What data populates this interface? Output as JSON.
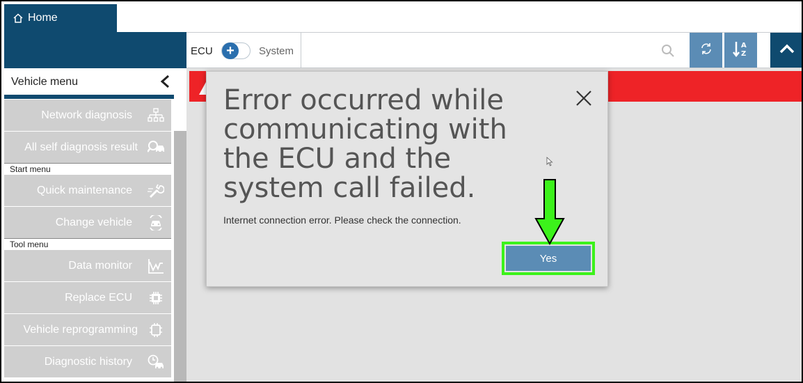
{
  "header": {
    "home_label": "Home"
  },
  "toolbar": {
    "ecu_label": "ECU",
    "system_label": "System",
    "toggle_icon": "plus-icon"
  },
  "sidebar": {
    "title": "Vehicle menu",
    "items_top": [
      {
        "label": "Network diagnosis",
        "icon": "network-icon"
      },
      {
        "label": "All self diagnosis result",
        "icon": "car-search-icon"
      }
    ],
    "start_menu_label": "Start menu",
    "start_items": [
      {
        "label": "Quick maintenance",
        "icon": "wrench-icon"
      },
      {
        "label": "Change vehicle",
        "icon": "car-swap-icon"
      }
    ],
    "tool_menu_label": "Tool menu",
    "tool_items": [
      {
        "label": "Data monitor",
        "icon": "chart-icon"
      },
      {
        "label": "Replace ECU",
        "icon": "chip-icon"
      },
      {
        "label": "Vehicle reprogramming",
        "icon": "chip-outline-icon"
      },
      {
        "label": "Diagnostic history",
        "icon": "history-car-icon"
      }
    ]
  },
  "dialog": {
    "title": "Error occurred while communicating with the ECU and the system call failed.",
    "message": "Internet connection error. Please check the connection.",
    "yes_label": "Yes"
  },
  "colors": {
    "brand_dark": "#0f4a6f",
    "button_blue": "#5b8cb5",
    "alert_red": "#ee2327",
    "highlight_green": "#3cf21b"
  }
}
